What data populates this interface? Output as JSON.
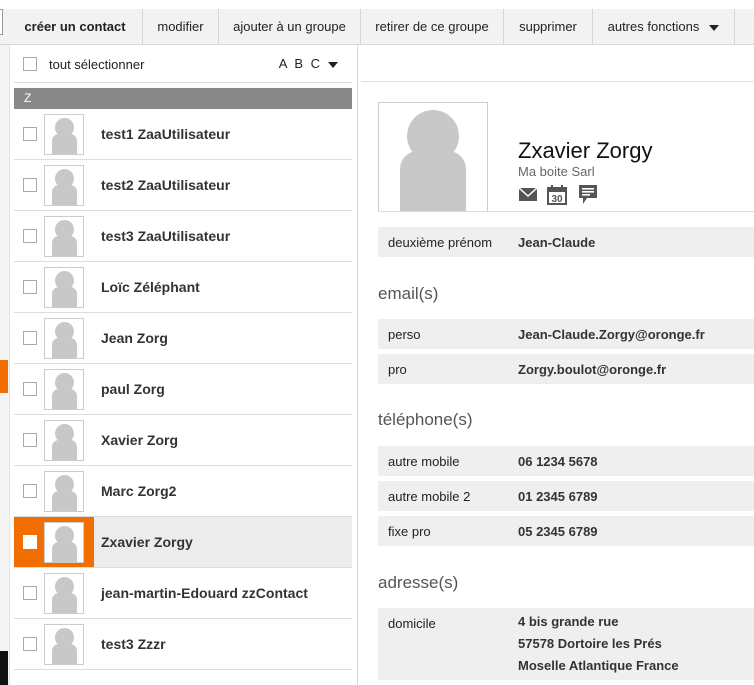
{
  "toolbar": {
    "create_contact": "créer un contact",
    "modify": "modifier",
    "add_to_group": "ajouter à un groupe",
    "remove_from_group": "retirer de ce groupe",
    "delete": "supprimer",
    "more_functions": "autres fonctions"
  },
  "list": {
    "select_all_label": "tout sélectionner",
    "alpha_index": "A B C",
    "letter_header": "Z",
    "contacts": [
      {
        "name": "test1 ZaaUtilisateur",
        "selected": false
      },
      {
        "name": "test2 ZaaUtilisateur",
        "selected": false
      },
      {
        "name": "test3 ZaaUtilisateur",
        "selected": false
      },
      {
        "name": "Loïc Zéléphant",
        "selected": false
      },
      {
        "name": "Jean Zorg",
        "selected": false
      },
      {
        "name": "paul Zorg",
        "selected": false
      },
      {
        "name": "Xavier Zorg",
        "selected": false
      },
      {
        "name": "Marc Zorg2",
        "selected": false
      },
      {
        "name": "Zxavier Zorgy",
        "selected": true
      },
      {
        "name": "jean-martin-Edouard zzContact",
        "selected": false
      },
      {
        "name": "test3 Zzzr",
        "selected": false
      }
    ]
  },
  "detail": {
    "name": "Zxavier Zorgy",
    "company": "Ma boite Sarl",
    "calendar_day": "30",
    "middle_name": {
      "label": "deuxième prénom",
      "value": "Jean-Claude"
    },
    "emails_title": "email(s)",
    "emails": [
      {
        "label": "perso",
        "value": "Jean-Claude.Zorgy@oronge.fr"
      },
      {
        "label": "pro",
        "value": "Zorgy.boulot@oronge.fr"
      }
    ],
    "phones_title": "téléphone(s)",
    "phones": [
      {
        "label": "autre mobile",
        "value": "06 1234 5678"
      },
      {
        "label": "autre mobile 2",
        "value": "01 2345 6789"
      },
      {
        "label": "fixe pro",
        "value": "05 2345 6789"
      }
    ],
    "addresses_title": "adresse(s)",
    "address": {
      "label": "domicile",
      "lines": [
        "4 bis grande rue",
        "57578 Dortoire les Prés",
        "Moselle Atlantique France"
      ]
    }
  },
  "colors": {
    "accent": "#f16e00",
    "header_gray": "#888888",
    "field_bg": "#efefef",
    "avatar_gray": "#c8c8c8"
  }
}
